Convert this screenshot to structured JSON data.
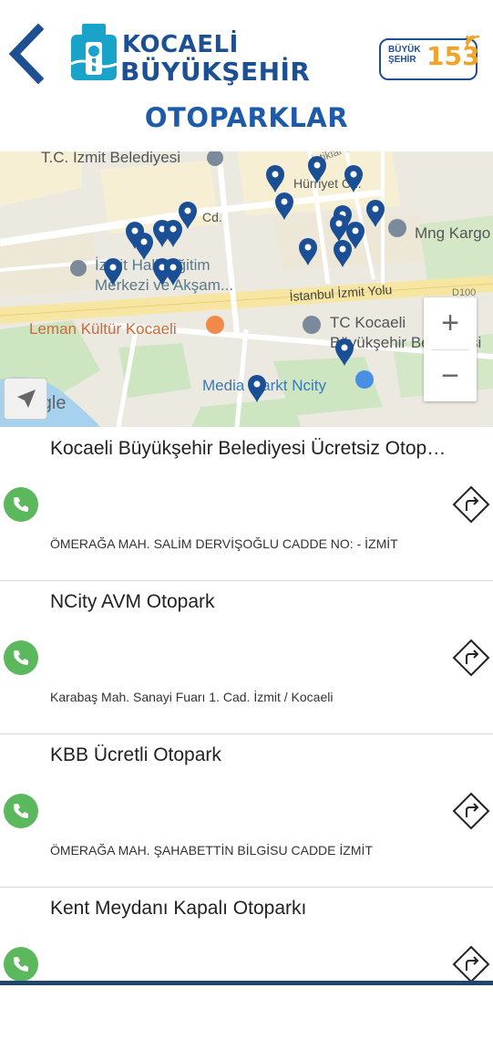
{
  "header": {
    "back_icon": "chevron-left-icon",
    "logo_line1": "KOCAELİ",
    "logo_line2": "BÜYÜKŞEHİR",
    "badge_small_line1": "BÜYÜK",
    "badge_small_line2": "ŞEHİR",
    "badge_number": "153"
  },
  "page_title": "OTOPARKLAR",
  "map": {
    "labels": {
      "municipality_top": "T.C. İzmit Belediyesi",
      "street1": "Cd.",
      "street2": "Hürriyet Cd.",
      "street3": "İstiklal Cd.",
      "street4": "Cd.",
      "education": "İzmit Halk Eğitim",
      "education2": "Merkezi ve Akşam...",
      "highway": "İstanbul İzmit Yolu",
      "highway_num": "D100",
      "culture": "Leman Kültür Kocaeli",
      "tc_kocaeli": "TC Kocaeli",
      "tc_kocaeli2": "Büyükşehir Belediyesi",
      "mng": "Mng Kargo",
      "media_markt": "Media Markt Ncity",
      "google": "Google"
    },
    "zoom_in": "+",
    "zoom_out": "−",
    "accent_color": "#1a4f95"
  },
  "parking_list": [
    {
      "name": "Kocaeli Büyükşehir Belediyesi Ücretsiz Otopark",
      "address": "ÖMERAĞA MAH. SALİM DERVİŞOĞLU CADDE NO: - İZMİT"
    },
    {
      "name": "NCity AVM Otopark",
      "address": "Karabaş Mah. Sanayi Fuarı 1. Cad. İzmit / Kocaeli"
    },
    {
      "name": "KBB Ücretli Otopark",
      "address": "ÖMERAĞA MAH. ŞAHABETTİN BİLGİSU CADDE  İZMİT"
    },
    {
      "name": "Kent Meydanı Kapalı Otoparkı",
      "address": ""
    }
  ],
  "colors": {
    "brand_blue": "#1d4f93",
    "title_blue": "#1d5aa8",
    "phone_green": "#5cb85c",
    "badge_orange": "#f2a32a"
  }
}
